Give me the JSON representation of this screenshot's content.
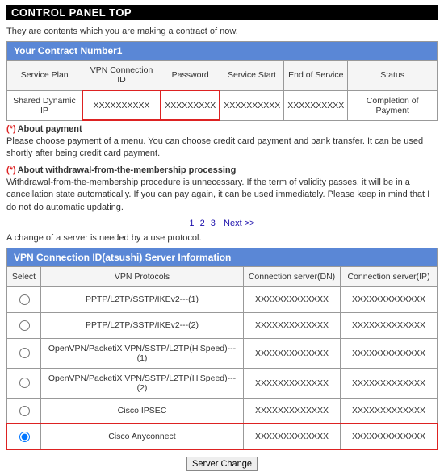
{
  "title": "CONTROL PANEL TOP",
  "intro": "They are contents which you are making a contract of now.",
  "contract": {
    "header": "Your Contract Number1",
    "cols": [
      "Service Plan",
      "VPN Connection ID",
      "Password",
      "Service Start",
      "End of Service",
      "Status"
    ],
    "row": {
      "plan": "Shared Dynamic IP",
      "vpnid": "XXXXXXXXXX",
      "password": "XXXXXXXXX",
      "start": "XXXXXXXXXX",
      "end": "XXXXXXXXXX",
      "status": "Completion of Payment"
    }
  },
  "notes": {
    "payment_head": "About payment",
    "payment_body": "Please choose payment of a menu. You can choose credit card payment and bank transfer. It can be used shortly after being credit card payment.",
    "withdraw_head": "About withdrawal-from-the-membership processing",
    "withdraw_body": "Withdrawal-from-the-membership procedure is unnecessary. If the term of validity passes, it will be in a cancellation state automatically. If you can pay again, it can be used immediately. Please keep in mind that I do not do automatic updating."
  },
  "pager": {
    "p1": "1",
    "p2": "2",
    "p3": "3",
    "next": "Next >>"
  },
  "subnote": "A change of a server is needed by a use protocol.",
  "server": {
    "header": "VPN Connection ID(atsushi) Server Information",
    "cols": [
      "Select",
      "VPN Protocols",
      "Connection server(DN)",
      "Connection server(IP)"
    ],
    "rows": [
      {
        "proto": "PPTP/L2TP/SSTP/IKEv2---(1)",
        "dn": "XXXXXXXXXXXXX",
        "ip": "XXXXXXXXXXXXX",
        "sel": false
      },
      {
        "proto": "PPTP/L2TP/SSTP/IKEv2---(2)",
        "dn": "XXXXXXXXXXXXX",
        "ip": "XXXXXXXXXXXXX",
        "sel": false
      },
      {
        "proto": "OpenVPN/PacketiX VPN/SSTP/L2TP(HiSpeed)---(1)",
        "dn": "XXXXXXXXXXXXX",
        "ip": "XXXXXXXXXXXXX",
        "sel": false
      },
      {
        "proto": "OpenVPN/PacketiX VPN/SSTP/L2TP(HiSpeed)---(2)",
        "dn": "XXXXXXXXXXXXX",
        "ip": "XXXXXXXXXXXXX",
        "sel": false
      },
      {
        "proto": "Cisco IPSEC",
        "dn": "XXXXXXXXXXXXX",
        "ip": "XXXXXXXXXXXXX",
        "sel": false
      },
      {
        "proto": "Cisco Anyconnect",
        "dn": "XXXXXXXXXXXXX",
        "ip": "XXXXXXXXXXXXX",
        "sel": true
      }
    ]
  },
  "button": "Server Change"
}
